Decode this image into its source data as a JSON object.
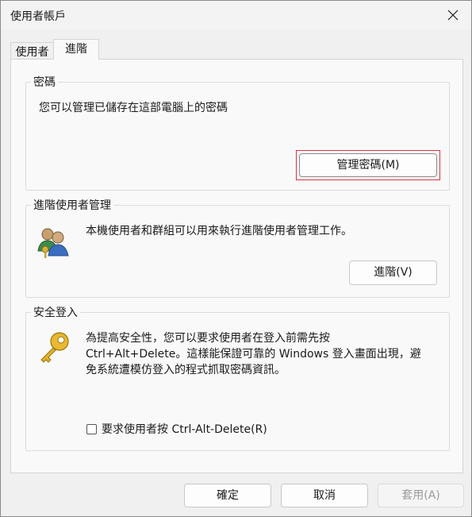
{
  "window": {
    "title": "使用者帳戶",
    "close_icon": "close-icon"
  },
  "tabs": [
    {
      "label": "使用者",
      "selected": false
    },
    {
      "label": "進階",
      "selected": true
    }
  ],
  "passwords": {
    "group_label": "密碼",
    "description": "您可以管理已儲存在這部電腦上的密碼",
    "button_label": "管理密碼(M)",
    "highlight_color": "#d9363e"
  },
  "advanced_user_mgmt": {
    "group_label": "進階使用者管理",
    "description": "本機使用者和群組可以用來執行進階使用者管理工作。",
    "button_label": "進階(V)",
    "icon": "users-group-icon"
  },
  "secure_logon": {
    "group_label": "安全登入",
    "description_lines": [
      "為提高安全性，您可以要求使用者在登入前需先按",
      "Ctrl+Alt+Delete。這樣能保證可靠的 Windows 登入畫面出現，避",
      "免系統遭模仿登入的程式抓取密碼資訊。"
    ],
    "checkbox_label": "要求使用者按 Ctrl-Alt-Delete(R)",
    "checkbox_checked": false,
    "icon": "key-icon"
  },
  "footer": {
    "ok_label": "確定",
    "cancel_label": "取消",
    "apply_label": "套用(A)",
    "apply_enabled": false
  }
}
